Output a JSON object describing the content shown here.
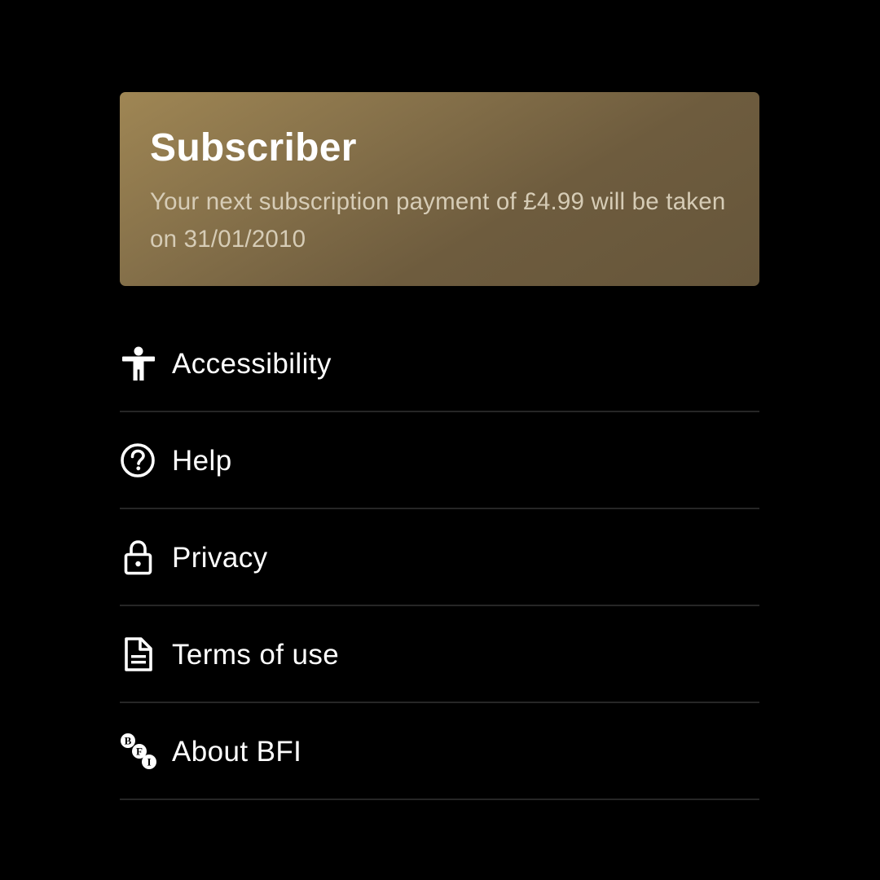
{
  "subscription_card": {
    "title": "Subscriber",
    "description": "Your next subscription payment of £4.99 will be taken on 31/01/2010",
    "gradient_start": "#9f8654",
    "gradient_end": "#66563b"
  },
  "menu": {
    "items": [
      {
        "label": "Accessibility",
        "icon": "accessibility-icon"
      },
      {
        "label": "Help",
        "icon": "help-circle-icon"
      },
      {
        "label": "Privacy",
        "icon": "lock-icon"
      },
      {
        "label": "Terms of use",
        "icon": "document-icon"
      },
      {
        "label": "About BFI",
        "icon": "bfi-logo-icon"
      }
    ]
  },
  "colors": {
    "background": "#000000",
    "text": "#ffffff",
    "divider": "#262626"
  }
}
